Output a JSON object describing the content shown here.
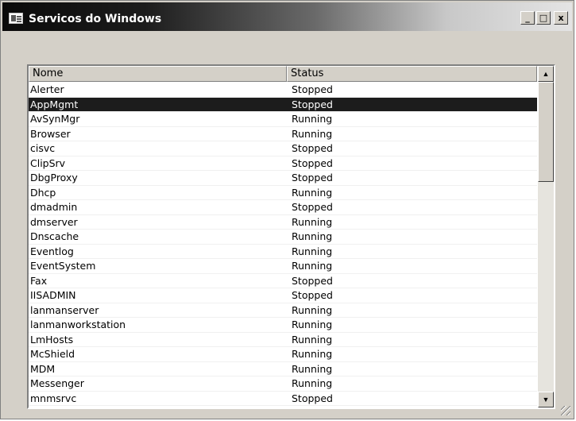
{
  "window": {
    "title": "Servicos do Windows",
    "minimize_label": "_",
    "maximize_label": "□",
    "close_label": "x"
  },
  "list": {
    "columns": [
      "Nome",
      "Status"
    ],
    "selected_index": 1,
    "rows": [
      {
        "name": "Alerter",
        "status": "Stopped"
      },
      {
        "name": "AppMgmt",
        "status": "Stopped"
      },
      {
        "name": "AvSynMgr",
        "status": "Running"
      },
      {
        "name": "Browser",
        "status": "Running"
      },
      {
        "name": "cisvc",
        "status": "Stopped"
      },
      {
        "name": "ClipSrv",
        "status": "Stopped"
      },
      {
        "name": "DbgProxy",
        "status": "Stopped"
      },
      {
        "name": "Dhcp",
        "status": "Running"
      },
      {
        "name": "dmadmin",
        "status": "Stopped"
      },
      {
        "name": "dmserver",
        "status": "Running"
      },
      {
        "name": "Dnscache",
        "status": "Running"
      },
      {
        "name": "Eventlog",
        "status": "Running"
      },
      {
        "name": "EventSystem",
        "status": "Running"
      },
      {
        "name": "Fax",
        "status": "Stopped"
      },
      {
        "name": "IISADMIN",
        "status": "Stopped"
      },
      {
        "name": "lanmanserver",
        "status": "Running"
      },
      {
        "name": "lanmanworkstation",
        "status": "Running"
      },
      {
        "name": "LmHosts",
        "status": "Running"
      },
      {
        "name": "McShield",
        "status": "Running"
      },
      {
        "name": "MDM",
        "status": "Running"
      },
      {
        "name": "Messenger",
        "status": "Running"
      },
      {
        "name": "mnmsrvc",
        "status": "Stopped"
      }
    ]
  },
  "scrollbar": {
    "up_arrow": "▲",
    "down_arrow": "▼"
  },
  "colors": {
    "selection": "#1c1c1c",
    "face": "#d4d0c8"
  },
  "icons": {
    "app": "window-app-icon",
    "grip": "resize-grip-icon"
  }
}
